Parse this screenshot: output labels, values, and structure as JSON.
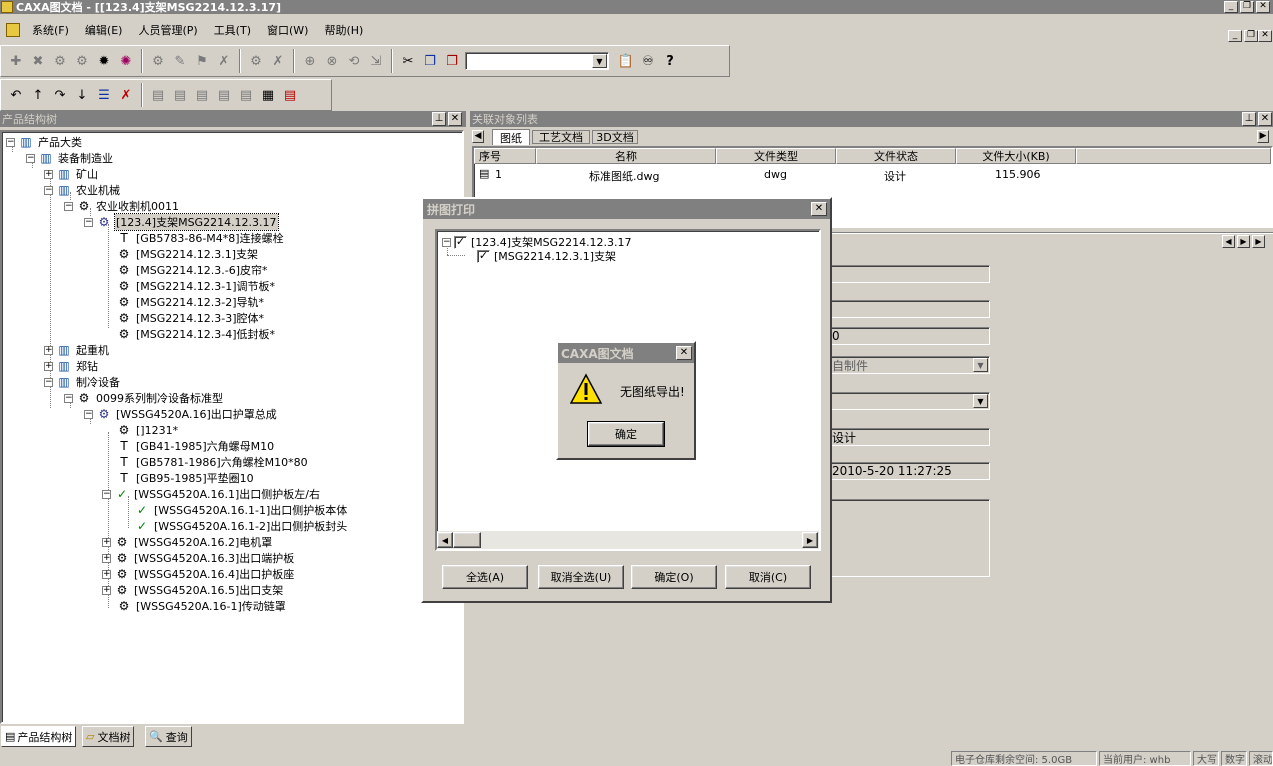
{
  "window": {
    "title": "CAXA图文档 - [[123.4]支架MSG2214.12.3.17]"
  },
  "menu": [
    "系统(F)",
    "编辑(E)",
    "人员管理(P)",
    "工具(T)",
    "窗口(W)",
    "帮助(H)"
  ],
  "toolbar": {
    "combo_value": ""
  },
  "left_panel": {
    "title": "产品结构树",
    "tree": [
      "产品大类",
      "装备制造业",
      "矿山",
      "农业机械",
      "农业收割机0011",
      "[123.4]支架MSG2214.12.3.17",
      "[GB5783-86-M4*8]连接螺栓",
      "[MSG2214.12.3.1]支架",
      "[MSG2214.12.3.-6]皮帘*",
      "[MSG2214.12.3-1]调节板*",
      "[MSG2214.12.3-2]导轨*",
      "[MSG2214.12.3-3]腔体*",
      "[MSG2214.12.3-4]低封板*",
      "起重机",
      "郑钻",
      "制冷设备",
      "0099系列制冷设备标准型",
      "[WSSG4520A.16]出口护罩总成",
      "[]1231*",
      "[GB41-1985]六角螺母M10",
      "[GB5781-1986]六角螺栓M10*80",
      "[GB95-1985]平垫圈10",
      "[WSSG4520A.16.1]出口侧护板左/右",
      "[WSSG4520A.16.1-1]出口侧护板本体",
      "[WSSG4520A.16.1-2]出口侧护板封头",
      "[WSSG4520A.16.2]电机罩",
      "[WSSG4520A.16.3]出口端护板",
      "[WSSG4520A.16.4]出口护板座",
      "[WSSG4520A.16.5]出口支架",
      "[WSSG4520A.16-1]传动链罩"
    ],
    "tabs": [
      "产品结构树",
      "文档树",
      "查询"
    ]
  },
  "right_panel": {
    "title": "关联对象列表",
    "tabs": [
      "图纸",
      "工艺文档",
      "3D文档"
    ],
    "columns": [
      "序号",
      "名称",
      "文件类型",
      "文件状态",
      "文件大小(KB)"
    ],
    "rows": [
      [
        "1",
        "标准图纸.dwg",
        "dwg",
        "设计",
        "115.906"
      ]
    ]
  },
  "properties": {
    "f3": "0",
    "f4": "自制件",
    "f5": "",
    "f6": "设计",
    "f7": "2010-5-20 11:27:25"
  },
  "print_dialog": {
    "title": "拼图打印",
    "tree": [
      "[123.4]支架MSG2214.12.3.17",
      "[MSG2214.12.3.1]支架"
    ],
    "buttons": [
      "全选(A)",
      "取消全选(U)",
      "确定(O)",
      "取消(C)"
    ]
  },
  "message_box": {
    "title": "CAXA图文档",
    "message": "无图纸导出!",
    "ok": "确定"
  },
  "status_bar": {
    "space": "电子仓库剩余空间: 5.0GB",
    "user": "当前用户: whb",
    "caps": "大写",
    "num": "数字",
    "scroll": "滚动"
  }
}
